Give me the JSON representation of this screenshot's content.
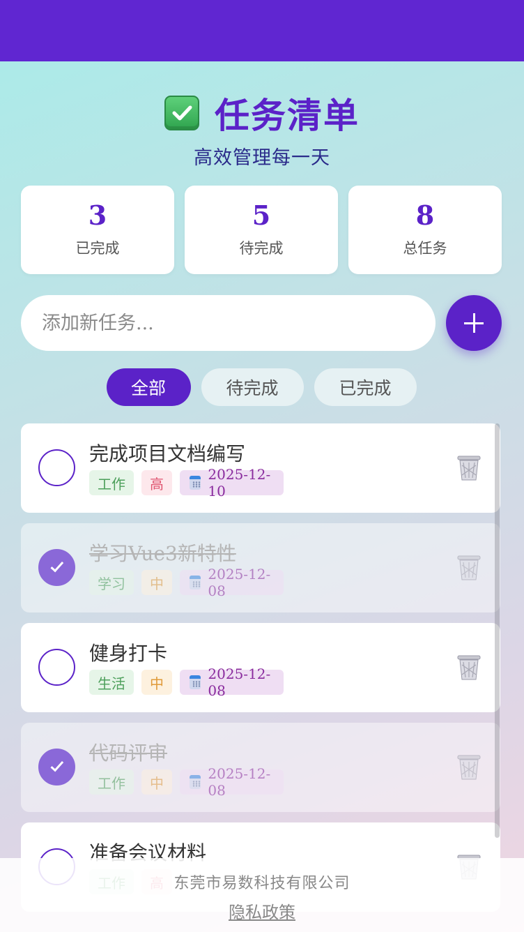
{
  "header": {
    "title": "任务清单",
    "subtitle": "高效管理每一天",
    "title_icon": "check-box-icon"
  },
  "stats": [
    {
      "value": "3",
      "label": "已完成"
    },
    {
      "value": "5",
      "label": "待完成"
    },
    {
      "value": "8",
      "label": "总任务"
    }
  ],
  "add": {
    "placeholder": "添加新任务...",
    "button_icon": "plus-icon"
  },
  "filters": [
    {
      "label": "全部",
      "active": true
    },
    {
      "label": "待完成",
      "active": false
    },
    {
      "label": "已完成",
      "active": false
    }
  ],
  "tasks": [
    {
      "name": "完成项目文档编写",
      "done": false,
      "category": "工作",
      "priority": "高",
      "date": "2025-12-10"
    },
    {
      "name": "学习Vue3新特性",
      "done": true,
      "category": "学习",
      "priority": "中",
      "date": "2025-12-08"
    },
    {
      "name": "健身打卡",
      "done": false,
      "category": "生活",
      "priority": "中",
      "date": "2025-12-08"
    },
    {
      "name": "代码评审",
      "done": true,
      "category": "工作",
      "priority": "中",
      "date": "2025-12-08"
    },
    {
      "name": "准备会议材料",
      "done": false,
      "category": "工作",
      "priority": "高",
      "date": ""
    }
  ],
  "footer": {
    "company": "东莞市易数科技有限公司",
    "privacy": "隐私政策"
  },
  "colors": {
    "brand": "#5b22c8",
    "topbar": "#6026d1"
  }
}
